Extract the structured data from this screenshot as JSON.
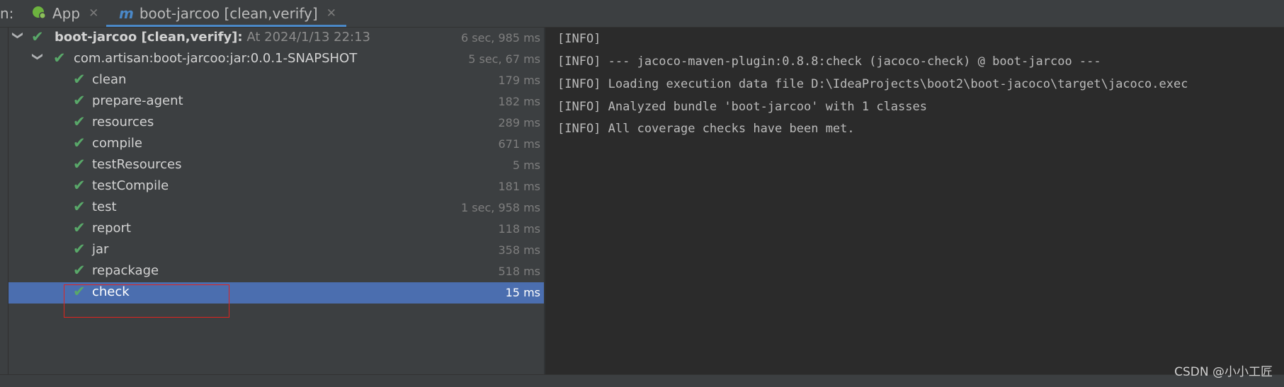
{
  "tabbar": {
    "run_label": "n:",
    "tabs": [
      {
        "label": "App",
        "icon": "spring-boot-icon"
      },
      {
        "label": "boot-jarcoo [clean,verify]",
        "icon": "maven-icon",
        "icon_glyph": "m"
      }
    ],
    "close_glyph": "✕"
  },
  "tree": {
    "root": {
      "label": "boot-jarcoo [clean,verify]:",
      "at": "At 2024/1/13 22:13",
      "duration": "6 sec, 985 ms"
    },
    "module": {
      "label": "com.artisan:boot-jarcoo:jar:0.0.1-SNAPSHOT",
      "duration": "5 sec, 67 ms"
    },
    "goals": [
      {
        "label": "clean",
        "duration": "179 ms"
      },
      {
        "label": "prepare-agent",
        "duration": "182 ms"
      },
      {
        "label": "resources",
        "duration": "289 ms"
      },
      {
        "label": "compile",
        "duration": "671 ms"
      },
      {
        "label": "testResources",
        "duration": "5 ms"
      },
      {
        "label": "testCompile",
        "duration": "181 ms"
      },
      {
        "label": "test",
        "duration": "1 sec, 958 ms"
      },
      {
        "label": "report",
        "duration": "118 ms"
      },
      {
        "label": "jar",
        "duration": "358 ms"
      },
      {
        "label": "repackage",
        "duration": "518 ms"
      },
      {
        "label": "check",
        "duration": "15 ms"
      }
    ],
    "selected": "check"
  },
  "console": {
    "lines": [
      "[INFO]",
      "[INFO] --- jacoco-maven-plugin:0.8.8:check (jacoco-check) @ boot-jarcoo ---",
      "[INFO] Loading execution data file D:\\IdeaProjects\\boot2\\boot-jacoco\\target\\jacoco.exec",
      "[INFO] Analyzed bundle 'boot-jarcoo' with 1 classes",
      "[INFO] All coverage checks have been met."
    ]
  },
  "colors": {
    "accent": "#4a88c7",
    "success": "#59a869",
    "selection": "#4b6eaf",
    "highlight_box": "#e0241e"
  },
  "watermark": "CSDN @小小工匠"
}
